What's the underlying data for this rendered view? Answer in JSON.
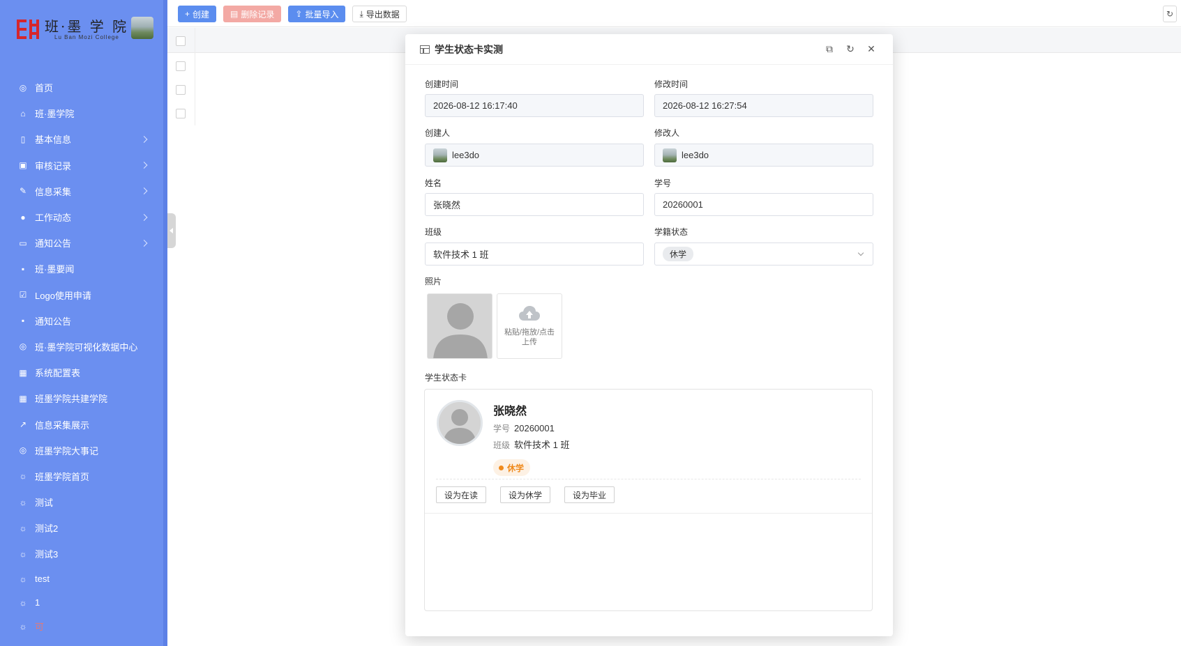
{
  "sidebar": {
    "logo_title": "班·墨 学 院",
    "logo_subtitle": "Lu Ban Mozi College",
    "items": [
      {
        "label": "首页",
        "icon": "globe-icon",
        "has_children": false
      },
      {
        "label": "班·墨学院",
        "icon": "home-icon",
        "has_children": false
      },
      {
        "label": "基本信息",
        "icon": "book-icon",
        "has_children": true
      },
      {
        "label": "审核记录",
        "icon": "briefcase-icon",
        "has_children": true
      },
      {
        "label": "信息采集",
        "icon": "pencil-icon",
        "has_children": true
      },
      {
        "label": "工作动态",
        "icon": "upload-circle-icon",
        "has_children": true
      },
      {
        "label": "通知公告",
        "icon": "message-icon",
        "has_children": true
      },
      {
        "label": "班·墨要闻",
        "icon": "chat-icon",
        "has_children": false
      },
      {
        "label": "Logo使用申请",
        "icon": "image-check-icon",
        "has_children": false
      },
      {
        "label": "通知公告",
        "icon": "chat-icon",
        "has_children": false
      },
      {
        "label": "班·墨学院可视化数据中心",
        "icon": "globe-icon",
        "has_children": false
      },
      {
        "label": "系统配置表",
        "icon": "table-icon",
        "has_children": false
      },
      {
        "label": "班墨学院共建学院",
        "icon": "table-icon",
        "has_children": false
      },
      {
        "label": "信息采集展示",
        "icon": "line-chart-icon",
        "has_children": false
      },
      {
        "label": "班墨学院大事记",
        "icon": "globe-icon",
        "has_children": false
      },
      {
        "label": "班墨学院首页",
        "icon": "bug-icon",
        "has_children": false
      },
      {
        "label": "测试",
        "icon": "bug-icon",
        "has_children": false
      },
      {
        "label": "测试2",
        "icon": "bug-icon",
        "has_children": false
      },
      {
        "label": "测试3",
        "icon": "bug-icon",
        "has_children": false
      },
      {
        "label": "test",
        "icon": "bug-icon",
        "has_children": false
      },
      {
        "label": "1",
        "icon": "bug-icon",
        "has_children": false
      },
      {
        "label": "可",
        "icon": "bug-icon",
        "has_children": false
      }
    ]
  },
  "toolbar": {
    "create_label": "创建",
    "delete_label": "删除记录",
    "import_label": "批量导入",
    "export_label": "导出数据"
  },
  "modal": {
    "title": "学生状态卡实测",
    "fields": {
      "created_at_label": "创建时间",
      "created_at": "2026-08-12 16:17:40",
      "updated_at_label": "修改时间",
      "updated_at": "2026-08-12 16:27:54",
      "creator_label": "创建人",
      "creator": "lee3do",
      "modifier_label": "修改人",
      "modifier": "lee3do",
      "name_label": "姓名",
      "name": "张晓然",
      "student_no_label": "学号",
      "student_no": "20260001",
      "class_label": "班级",
      "class": "软件技术 1 班",
      "status_label": "学籍状态",
      "status": "休学",
      "photo_label": "照片",
      "upload_hint": "粘贴/拖放/点击上传"
    },
    "card": {
      "section_label": "学生状态卡",
      "name": "张晓然",
      "no_key": "学号",
      "no_value": "20260001",
      "class_key": "班级",
      "class_value": "软件技术 1 班",
      "status": "休学",
      "btn_studying": "设为在读",
      "btn_suspend": "设为休学",
      "btn_graduate": "设为毕业"
    }
  },
  "colors": {
    "sidebar_bg": "#6b8ff0",
    "primary": "#5b8def",
    "danger_disabled": "#f3a9a4",
    "status_orange": "#ef8a1d"
  }
}
